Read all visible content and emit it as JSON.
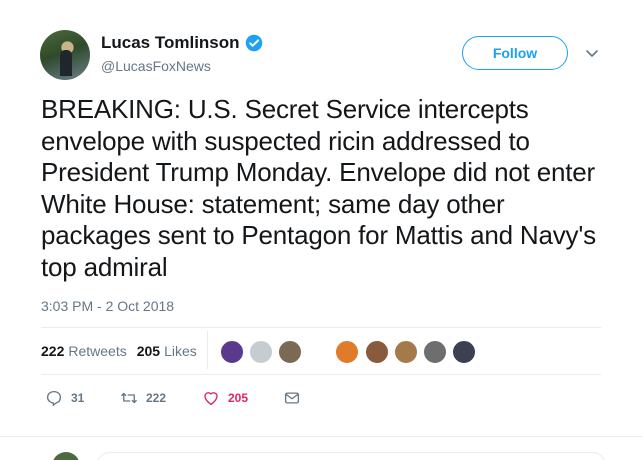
{
  "user": {
    "name": "Lucas Tomlinson",
    "handle": "@LucasFoxNews"
  },
  "follow_label": "Follow",
  "tweet": {
    "text": "BREAKING: U.S. Secret Service intercepts envelope with suspected ricin addressed to President Trump Monday. Envelope did not enter White House: statement; same day other packages sent to Pentagon for Mattis and Navy's top admiral",
    "timestamp": "3:03 PM - 2 Oct 2018"
  },
  "stats": {
    "retweets_count": "222",
    "retweets_label": "Retweets",
    "likes_count": "205",
    "likes_label": "Likes"
  },
  "actions": {
    "reply_count": "31",
    "retweet_count": "222",
    "like_count": "205"
  },
  "colors": {
    "accent": "#1da1f2",
    "like": "#e0245e",
    "muted": "#657786"
  },
  "likers": [
    {
      "color": "#5b3a8c"
    },
    {
      "color": "#c7ccd1"
    },
    {
      "color": "#7a6a55"
    },
    {
      "color": "#e07b2a"
    },
    {
      "color": "#8a5a3c"
    },
    {
      "color": "#a57a4a"
    },
    {
      "color": "#6e6e6e"
    },
    {
      "color": "#3d3f52"
    }
  ]
}
